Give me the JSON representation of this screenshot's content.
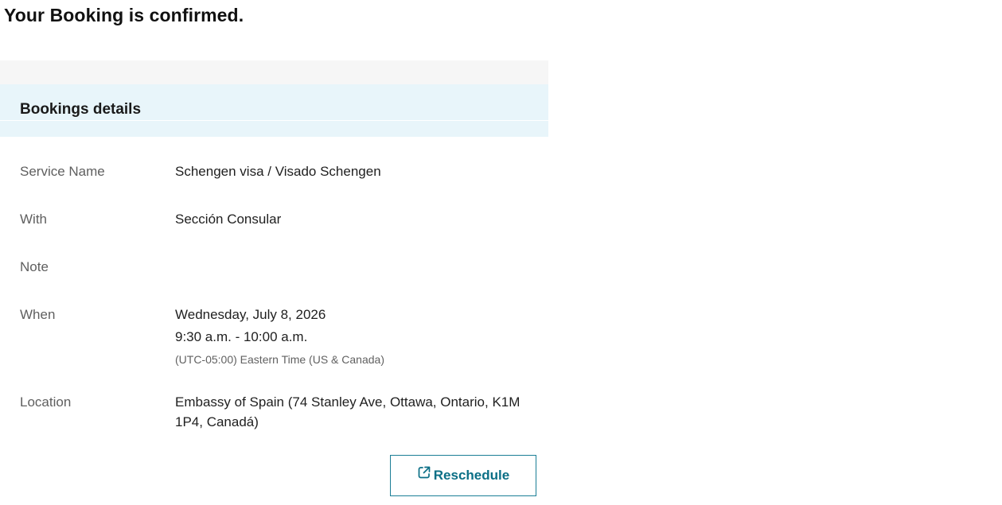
{
  "page": {
    "title": "Your Booking is confirmed."
  },
  "details": {
    "section_title": "Bookings details",
    "rows": [
      {
        "label": "Service Name",
        "value": "Schengen visa / Visado Schengen"
      },
      {
        "label": "With",
        "value": "Sección Consular"
      },
      {
        "label": "Note",
        "value": ""
      },
      {
        "label": "When",
        "date": "Wednesday, July 8, 2026",
        "time": "9:30 a.m. - 10:00 a.m.",
        "timezone": "(UTC-05:00) Eastern Time (US & Canada)"
      },
      {
        "label": "Location",
        "value": "Embassy of Spain (74 Stanley Ave, Ottawa, Ontario, K1M 1P4, Canadá)"
      }
    ]
  },
  "actions": {
    "reschedule_label": "Reschedule",
    "reschedule_icon": "external-link-icon"
  },
  "colors": {
    "header_background": "#e8f5fa",
    "accent": "#0b6f86",
    "button_border": "#1b7e96",
    "label_text": "#5f5f5f"
  }
}
